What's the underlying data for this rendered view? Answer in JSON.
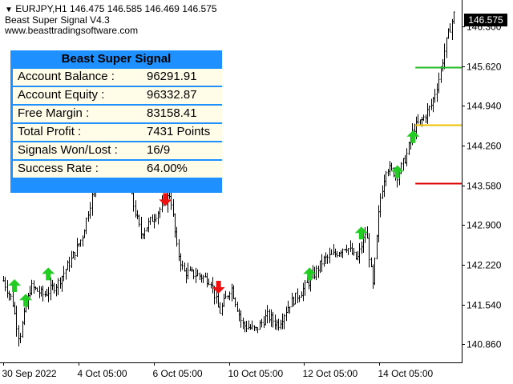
{
  "header": {
    "symbol_line": "EURJPY,H1  146.475 146.585 146.469 146.575",
    "indicator_name": "Beast Super Signal V4.3",
    "website": "www.beasttradingsoftware.com",
    "dropdown_icon": "triangle-down-icon"
  },
  "panel": {
    "title": "Beast Super Signal",
    "rows": [
      {
        "label": "Account Balance :",
        "value": "96291.91"
      },
      {
        "label": "Account Equity :",
        "value": "96332.87"
      },
      {
        "label": "Free Margin :",
        "value": "83158.41"
      },
      {
        "label": "Total Profit :",
        "value": "7431 Points"
      },
      {
        "label": "Signals Won/Lost :",
        "value": "16/9"
      },
      {
        "label": "Success Rate :",
        "value": "64.00%"
      }
    ]
  },
  "price_axis": {
    "current_price": "146.575",
    "ticks": [
      "146.300",
      "145.620",
      "144.940",
      "144.260",
      "143.580",
      "142.900",
      "142.220",
      "141.540",
      "140.860"
    ]
  },
  "time_axis": {
    "labels": [
      "30 Sep 2022",
      "4 Oct 05:00",
      "6 Oct 05:00",
      "10 Oct 05:00",
      "12 Oct 05:00",
      "14 Oct 05:00"
    ]
  },
  "colors": {
    "buy_arrow": "#22cc22",
    "sell_arrow": "#ee1111",
    "take_profit_line": "#22bb22",
    "entry_line": "#f0c000",
    "stop_loss_line": "#dd0000",
    "panel_blue": "#1e90ff",
    "panel_row_bg": "#fffde8"
  },
  "chart_data": {
    "type": "ohlc",
    "timeframe": "H1",
    "symbol": "EURJPY",
    "yrange": [
      140.55,
      146.75
    ],
    "path_points": [
      [
        0,
        141.95
      ],
      [
        0.02,
        141.6
      ],
      [
        0.035,
        140.95
      ],
      [
        0.06,
        141.85
      ],
      [
        0.09,
        141.7
      ],
      [
        0.12,
        141.9
      ],
      [
        0.15,
        142.3
      ],
      [
        0.175,
        142.7
      ],
      [
        0.195,
        143.35
      ],
      [
        0.215,
        143.75
      ],
      [
        0.245,
        143.65
      ],
      [
        0.265,
        143.85
      ],
      [
        0.285,
        143.35
      ],
      [
        0.305,
        142.75
      ],
      [
        0.325,
        142.95
      ],
      [
        0.355,
        143.25
      ],
      [
        0.37,
        143.45
      ],
      [
        0.385,
        142.5
      ],
      [
        0.4,
        142.1
      ],
      [
        0.43,
        142.05
      ],
      [
        0.46,
        141.95
      ],
      [
        0.48,
        141.4
      ],
      [
        0.505,
        141.85
      ],
      [
        0.53,
        141.2
      ],
      [
        0.56,
        141.1
      ],
      [
        0.585,
        141.35
      ],
      [
        0.61,
        141.2
      ],
      [
        0.635,
        141.55
      ],
      [
        0.66,
        141.75
      ],
      [
        0.685,
        142.0
      ],
      [
        0.71,
        142.3
      ],
      [
        0.735,
        142.4
      ],
      [
        0.76,
        142.55
      ],
      [
        0.785,
        142.3
      ],
      [
        0.805,
        142.8
      ],
      [
        0.82,
        141.85
      ],
      [
        0.835,
        143.3
      ],
      [
        0.85,
        143.9
      ],
      [
        0.875,
        143.75
      ],
      [
        0.895,
        144.1
      ],
      [
        0.91,
        144.55
      ],
      [
        0.93,
        144.7
      ],
      [
        0.95,
        144.95
      ],
      [
        0.965,
        145.35
      ],
      [
        0.985,
        146.1
      ],
      [
        1.0,
        146.5
      ]
    ],
    "signals": [
      {
        "t": 0.025,
        "price": 141.85,
        "dir": "buy"
      },
      {
        "t": 0.05,
        "price": 141.6,
        "dir": "buy"
      },
      {
        "t": 0.1,
        "price": 142.05,
        "dir": "buy"
      },
      {
        "t": 0.36,
        "price": 143.35,
        "dir": "sell"
      },
      {
        "t": 0.478,
        "price": 141.85,
        "dir": "sell"
      },
      {
        "t": 0.68,
        "price": 142.05,
        "dir": "buy"
      },
      {
        "t": 0.795,
        "price": 142.75,
        "dir": "buy"
      },
      {
        "t": 0.875,
        "price": 143.8,
        "dir": "buy"
      },
      {
        "t": 0.91,
        "price": 144.4,
        "dir": "buy"
      }
    ],
    "levels": [
      {
        "name": "take_profit",
        "price": 145.6,
        "color": "#22bb22",
        "t_start": 0.915
      },
      {
        "name": "entry",
        "price": 144.62,
        "color": "#f0c000",
        "t_start": 0.915
      },
      {
        "name": "stop_loss",
        "price": 143.62,
        "color": "#dd0000",
        "t_start": 0.915
      }
    ]
  }
}
